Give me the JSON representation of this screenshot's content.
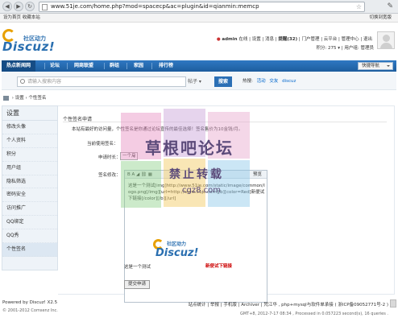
{
  "browser": {
    "url": "www.51je.com/home.php?mod=spacecp&ac=plugin&id=qianmin:memcp"
  },
  "topbar": {
    "left": "设为首页  收藏本站",
    "right": "切换到宽版"
  },
  "logo": {
    "cn": "社区动力",
    "en": "Discuz!"
  },
  "user": {
    "name": "admin",
    "status": "在线",
    "links": "| 设置 | 消息 |",
    "reminder": "提醒(32)",
    "rest": "| 门户管理 | 云平台 | 管理中心 | 退出",
    "points": "积分: 275 ▾   |   用户组: 管理员"
  },
  "nav": {
    "items": [
      "热点新闻网",
      "论坛",
      "网商联盟",
      "群组",
      "家园",
      "排行榜"
    ],
    "quicknav": "快捷导航"
  },
  "search": {
    "placeholder": "请输入搜索内容",
    "type": "帖子 ▾",
    "button": "搜索",
    "hot_label": "热搜:",
    "hot": [
      "活动",
      "交友",
      "discuz"
    ]
  },
  "breadcrumb": "›  设置  ›  个性签名",
  "sidebar": {
    "title": "设置",
    "items": [
      "修改头像",
      "个人资料",
      "积分",
      "用户组",
      "隐私筛选",
      "密码安全",
      "访问推广",
      "QQ绑定",
      "QQ秀",
      "个性签名"
    ]
  },
  "main": {
    "title": "个性签名申请",
    "intro": "本站有最好的访问量，个性签名是你通过论坛宣传的最佳选择！签名售价为10金钱/月。",
    "label_current": "当前使用签名：",
    "label_duration": "申请时长：",
    "duration_value": "一个月",
    "label_content": "签名修改：",
    "toolbar": "B  A  ◢  ⛓  ▦",
    "preview": "预览",
    "content": "这是一个测试[img]http://www.51je.com/static/image/common/logo.png[/img][url=http://www.51je.com][b][color=Red]新便试下链接[/color][/b][/url]",
    "preview_prefix": "这是一个测试",
    "preview_link": "新便试下链接",
    "submit": "提交申请"
  },
  "footer": {
    "powered": "Powered by Discuz! X2.5",
    "copyright": "© 2001-2012 Comsenz Inc.",
    "links": "站点统计  |  举报  |  手机版  |  Archiver  |  梵江华 , php+mysql与软件单承接  ( 浙ICP备09052771号-2 )",
    "gmt": "GMT+8, 2012-7-17 08:34 , Processed in 0.057223 second(s), 16 queries ."
  },
  "watermark": {
    "line1": "草根吧论坛",
    "line2": "禁止转载",
    "line3": "cgz8.com"
  }
}
